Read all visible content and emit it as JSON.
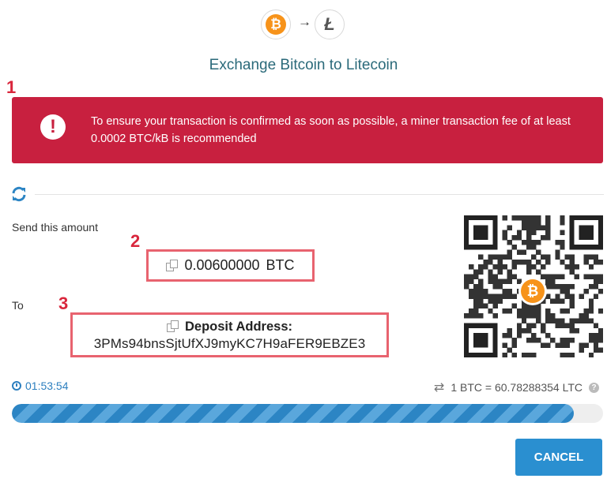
{
  "header": {
    "from_coin": "bitcoin-icon",
    "to_coin": "litecoin-icon",
    "arrow": "→",
    "title": "Exchange Bitcoin to Litecoin"
  },
  "markers": [
    "1",
    "2",
    "3"
  ],
  "alert": {
    "icon": "exclamation-icon",
    "text": "To ensure your transaction is confirmed as soon as possible, a miner transaction fee of at least 0.0002 BTC/kB is recommended",
    "color": "#c8203f"
  },
  "send": {
    "label": "Send this amount",
    "amount": "0.00600000",
    "currency": "BTC"
  },
  "to": {
    "label": "To",
    "deposit_heading": "Deposit Address:",
    "address": "3PMs94bnsSjtUfXJ9myKC7H9aFER9EBZE3"
  },
  "timer": "01:53:54",
  "rate": "1 BTC = 60.78288354 LTC",
  "progress": {
    "fraction": 0.95,
    "color": "#2c85c4"
  },
  "cancel_label": "CANCEL",
  "colors": {
    "accent": "#2a8fd0",
    "title": "#2b6a7a",
    "highlight_border": "#e8636f",
    "bitcoin": "#f7931a"
  }
}
